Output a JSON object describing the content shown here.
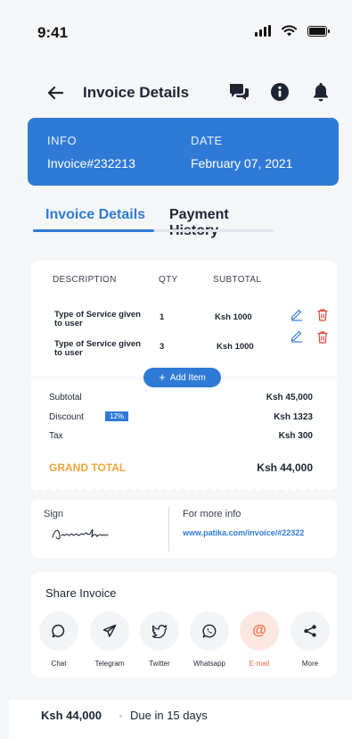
{
  "status": {
    "time": "9:41"
  },
  "header": {
    "title": "Invoice Details"
  },
  "info": {
    "info_label": "INFO",
    "info_value": "Invoice#232213",
    "date_label": "DATE",
    "date_value": "February 07, 2021"
  },
  "tabs": [
    {
      "label": "Invoice Details",
      "active": true
    },
    {
      "label": "Payment History",
      "active": false
    }
  ],
  "items_table": {
    "columns": [
      "DESCRIPTION",
      "QTY",
      "SUBTOTAL"
    ],
    "rows": [
      {
        "description": "Type of Service given to user",
        "qty": "1",
        "subtotal": "Ksh 1000"
      },
      {
        "description": "Type of Service given to user",
        "qty": "3",
        "subtotal": "Ksh 1000"
      }
    ],
    "add_item_label": "Add Item"
  },
  "totals": {
    "subtotal_label": "Subtotal",
    "subtotal_value": "Ksh 45,000",
    "discount_label": "Discount",
    "discount_badge": "12%",
    "discount_value": "Ksh 1323",
    "tax_label": "Tax",
    "tax_value": "Ksh 300",
    "grand_label": "GRAND TOTAL",
    "grand_value": "Ksh 44,000"
  },
  "sign": {
    "label": "Sign",
    "more_label": "For more info",
    "more_link": "www.patika.com/invoice/#22322"
  },
  "share": {
    "title": "Share Invoice",
    "items": [
      {
        "label": "Chat",
        "icon": "chat-icon"
      },
      {
        "label": "Telegram",
        "icon": "telegram-icon"
      },
      {
        "label": "Twitter",
        "icon": "twitter-icon"
      },
      {
        "label": "Whatsapp",
        "icon": "whatsapp-icon"
      },
      {
        "label": "E-mail",
        "icon": "email-icon"
      },
      {
        "label": "More",
        "icon": "share-icon"
      }
    ]
  },
  "footer": {
    "total": "Ksh 44,000",
    "due": "Due in 15 days"
  },
  "colors": {
    "accent": "#2f7ad6",
    "grand_total": "#f2a53a",
    "email": "#ef6a45"
  }
}
